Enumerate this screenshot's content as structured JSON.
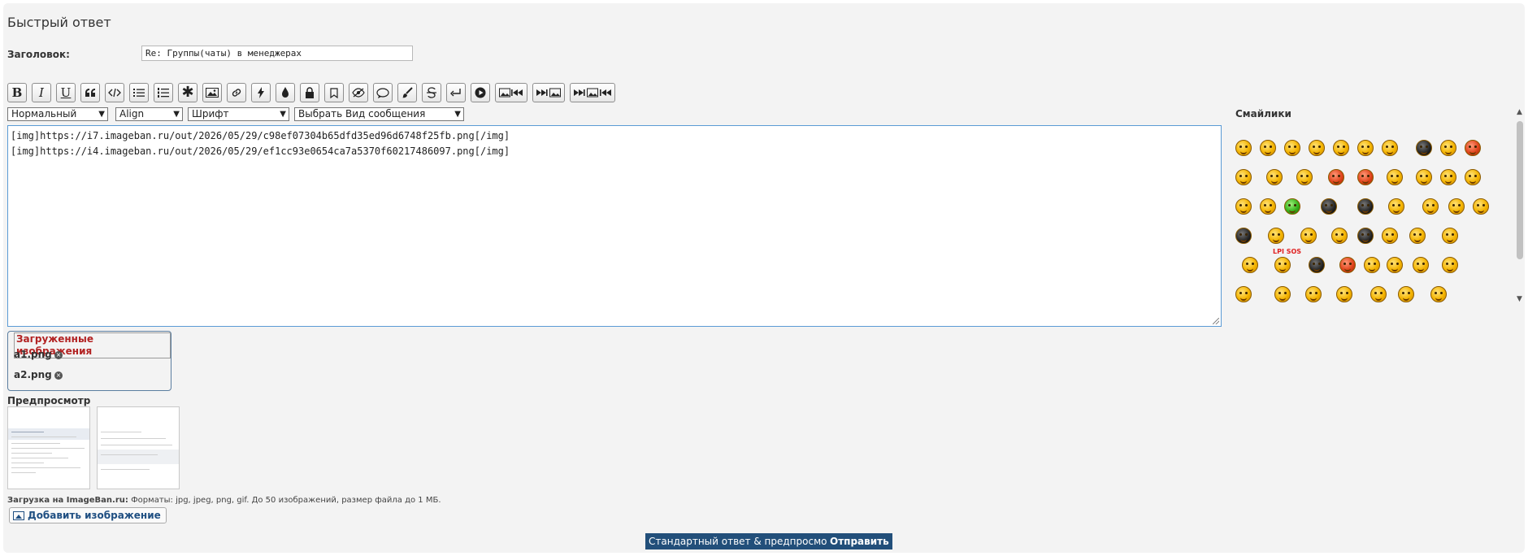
{
  "form": {
    "title": "Быстрый ответ",
    "subject_label": "Заголовок:",
    "subject_value": "Re: Группы(чаты) в менеджерах"
  },
  "toolbar": {
    "buttons": [
      "bold-icon",
      "italic-icon",
      "underline-icon",
      "quote-icon",
      "code-icon",
      "bulleted-list-icon",
      "numbered-list-icon",
      "asterisk-icon",
      "image-icon",
      "link-icon",
      "flash-icon",
      "drop-icon",
      "lock-icon",
      "bookmark-icon",
      "hide-icon",
      "speech-bubble-icon",
      "brush-icon",
      "strikethrough-icon",
      "enter-icon",
      "play-icon",
      "image-prev-icon",
      "next-image-icon",
      "next-image-prev-icon"
    ],
    "bold": "B",
    "italic": "I",
    "underline": "U"
  },
  "selects": {
    "size": "Нормальный",
    "align": "Align",
    "font": "Шрифт",
    "message_type": "Выбрать Вид сообщения"
  },
  "editor": {
    "content": "[img]https://i7.imageban.ru/out/2026/05/29/c98ef07304b65dfd35ed96d6748f25fb.png[/img]\n[img]https://i4.imageban.ru/out/2026/05/29/ef1cc93e0654ca7a5370f60217486097.png[/img]"
  },
  "smilies": {
    "title": "Смайлики",
    "sos_text": "LPI SOS"
  },
  "uploads": {
    "legend": "Загруженные изображения",
    "items": [
      {
        "name": "a1.png"
      },
      {
        "name": "a2.png"
      }
    ]
  },
  "preview": {
    "label": "Предпросмотр"
  },
  "upload_note": {
    "service": "Загрузка на ImageBan.ru:",
    "details": " Форматы: jpg, jpeg, png, gif. До 50 изображений, размер файла до 1 МБ."
  },
  "buttons": {
    "add_image": "Добавить изображение",
    "standard_reply": "Стандартный ответ & предпросмотр",
    "send": "Отправить"
  }
}
